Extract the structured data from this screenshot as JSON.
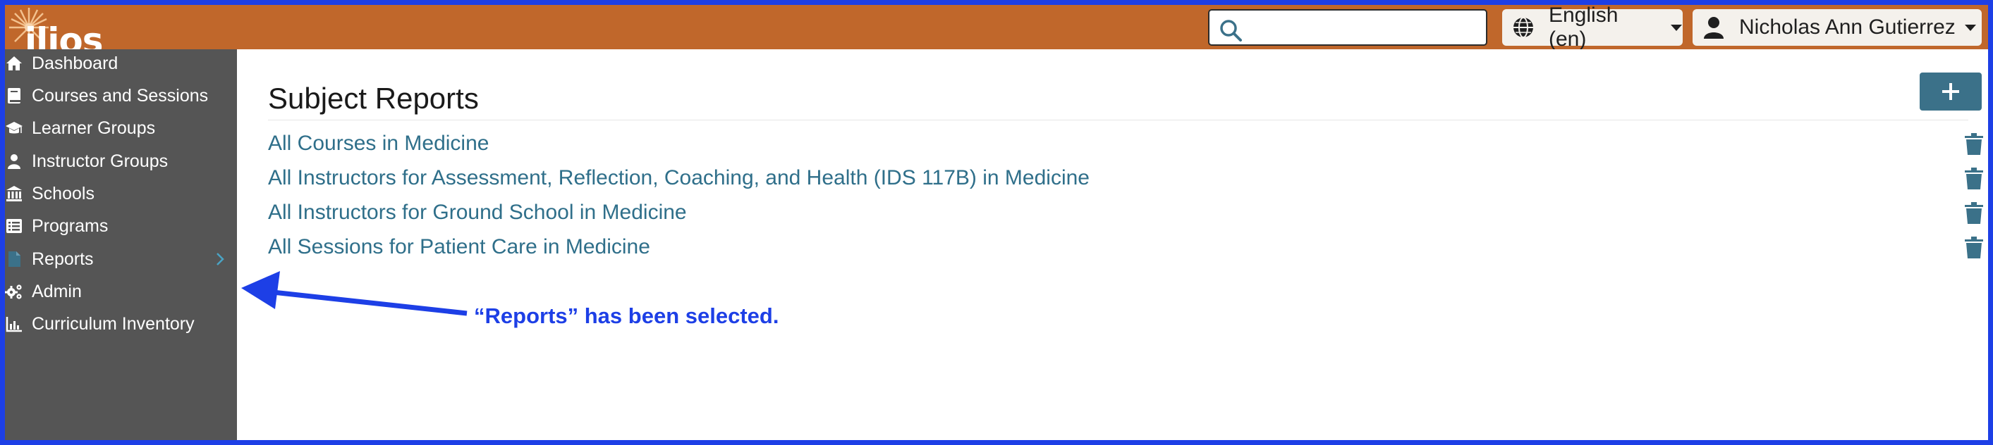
{
  "app": {
    "logo_text": "ilios"
  },
  "header": {
    "search": {
      "placeholder": "",
      "value": ""
    },
    "language_label": "English (en)",
    "user_label": "Nicholas Ann Gutierrez"
  },
  "sidebar": {
    "items": [
      {
        "label": "Dashboard",
        "icon": "home-icon"
      },
      {
        "label": "Courses and Sessions",
        "icon": "book-icon"
      },
      {
        "label": "Learner Groups",
        "icon": "graduation-cap-icon"
      },
      {
        "label": "Instructor Groups",
        "icon": "user-icon"
      },
      {
        "label": "Schools",
        "icon": "school-building-icon"
      },
      {
        "label": "Programs",
        "icon": "list-icon"
      },
      {
        "label": "Reports",
        "icon": "file-icon",
        "selected": true
      },
      {
        "label": "Admin",
        "icon": "gears-icon"
      },
      {
        "label": "Curriculum Inventory",
        "icon": "chart-icon"
      }
    ]
  },
  "main": {
    "title": "Subject Reports",
    "add_button_icon": "plus-icon",
    "reports": [
      {
        "label": "All Courses in Medicine"
      },
      {
        "label": "All Instructors for Assessment, Reflection, Coaching, and Health (IDS 117B) in Medicine"
      },
      {
        "label": "All Instructors for Ground School in Medicine"
      },
      {
        "label": "All Sessions for Patient Care in Medicine"
      }
    ]
  },
  "annotation": {
    "text": "“Reports” has been selected."
  },
  "colors": {
    "header": "#c0672b",
    "sidebar": "#555555",
    "link": "#2f6f8a",
    "accent": "#3b7189",
    "annotation": "#1d3fe6"
  }
}
